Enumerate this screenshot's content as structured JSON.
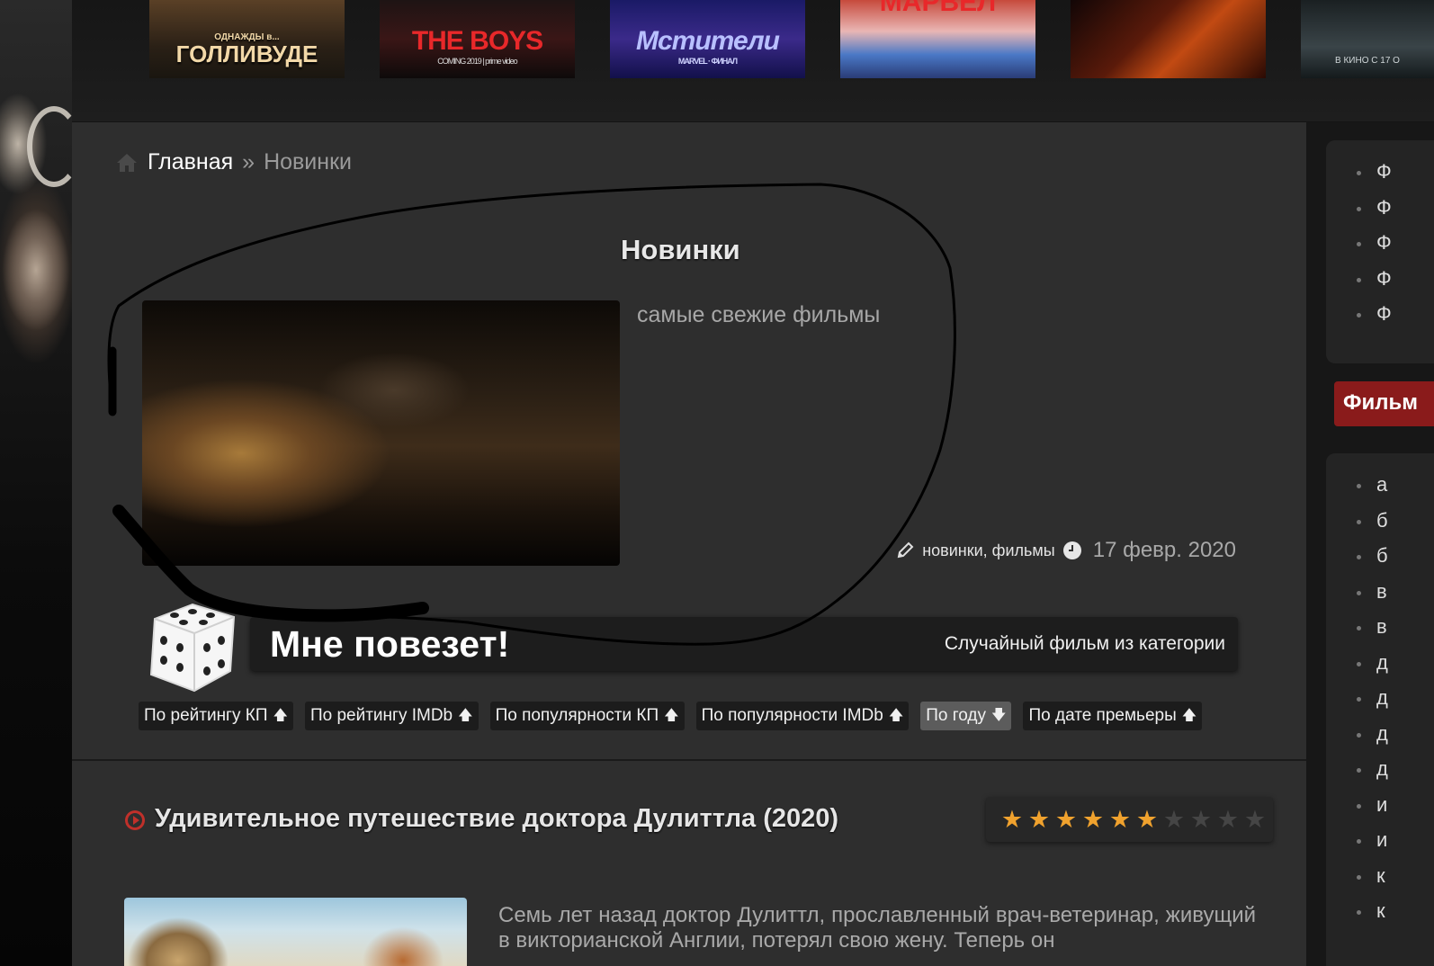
{
  "posters": [
    {
      "text": "ГОЛЛИВУДЕ",
      "subtext": "ОДНАЖДЫ в..."
    },
    {
      "text": "THE BOYS",
      "subtext": "COMING 2019 | prime video"
    },
    {
      "text": "Мстители",
      "subtext": "MARVEL · ФИНАЛ"
    },
    {
      "text": "МАРВЕЛ",
      "subtext": ""
    },
    {
      "text": "",
      "subtext": ""
    },
    {
      "text": "",
      "subtext": "В КИНО С 17 О"
    }
  ],
  "breadcrumb": {
    "home": "Главная",
    "separator": "»",
    "current": "Новинки"
  },
  "category": {
    "title": "Новинки",
    "description": "самые свежие фильмы",
    "tags": "новинки, фильмы",
    "date": "17 февр. 2020"
  },
  "lucky": {
    "title": "Мне повезет!",
    "subtitle": "Случайный фильм из категории"
  },
  "sort_buttons": [
    {
      "label": "По рейтингу КП",
      "arrow": "🡅",
      "active": false
    },
    {
      "label": "По рейтингу IMDb",
      "arrow": "🡅",
      "active": false
    },
    {
      "label": "По популярности КП",
      "arrow": "🡅",
      "active": false
    },
    {
      "label": "По популярности IMDb",
      "arrow": "🡅",
      "active": false
    },
    {
      "label": "По году",
      "arrow": "🡇",
      "active": true
    },
    {
      "label": "По дате премьеры",
      "arrow": "🡅",
      "active": false
    }
  ],
  "movie": {
    "title": "Удивительное путешествие доктора Дулиттла (2020)",
    "rating_filled": 6,
    "rating_max": 10,
    "description": "Семь лет назад доктор Дулиттл, прославленный врач-ветеринар, живущий в викторианской Англии, потерял свою жену. Теперь он"
  },
  "sidebar": {
    "top_items": [
      "Ф",
      "Ф",
      "Ф",
      "Ф",
      "Ф"
    ],
    "red_label": "Фильм",
    "list_items": [
      "а",
      "б",
      "б",
      "в",
      "в",
      "д",
      "д",
      "д",
      "д",
      "и",
      "и",
      "к",
      "к"
    ]
  },
  "colors": {
    "accent_red": "#8a1b1b",
    "star_on": "#f0a22e",
    "panel": "#2e2e2e"
  }
}
